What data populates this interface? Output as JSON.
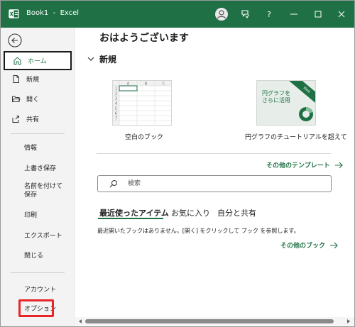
{
  "titlebar": {
    "document_name": "Book1",
    "separator": "-",
    "app_name": "Excel",
    "title": "Book1  -  Excel",
    "help_label": "?"
  },
  "sidebar": {
    "items": [
      {
        "label": "ホーム",
        "icon": "home-icon",
        "active": true
      },
      {
        "label": "新規",
        "icon": "new-document-icon"
      },
      {
        "label": "開く",
        "icon": "open-folder-icon"
      },
      {
        "label": "共有",
        "icon": "share-icon"
      }
    ],
    "sub_items": [
      {
        "label": "情報"
      },
      {
        "label": "上書き保存"
      },
      {
        "label": "名前を付けて保存"
      },
      {
        "label": "印刷"
      },
      {
        "label": "エクスポート"
      },
      {
        "label": "閉じる"
      }
    ],
    "bottom_items": [
      {
        "label": "アカウント"
      },
      {
        "label": "オプション",
        "highlighted": true
      }
    ]
  },
  "main": {
    "greeting": "おはようございます",
    "new_section": {
      "heading": "新規",
      "templates": [
        {
          "label": "空白のブック"
        },
        {
          "label": "円グラフのチュートリアルを超えて",
          "thumbnail_text": "円グラフを\nさらに活用",
          "ribbon_text": "New"
        }
      ],
      "more_templates_link": "その他のテンプレート"
    },
    "search": {
      "placeholder": "検索",
      "value": ""
    },
    "tabs": [
      {
        "label": "最近使ったアイテム",
        "active": true
      },
      {
        "label": "お気に入り"
      },
      {
        "label": "自分と共有"
      }
    ],
    "empty_message": "最近開いたブックはありません。[開く] をクリックして ブック を参照します。",
    "more_workbooks_link": "その他のブック"
  },
  "spreadsheet_thumb": {
    "columns": [
      "A",
      "B",
      "C"
    ],
    "rows": [
      "1",
      "2",
      "3",
      "4",
      "5",
      "6",
      "7"
    ]
  },
  "colors": {
    "titlebar": "#1f7145",
    "accent": "#1f7145",
    "sidebar_bg": "#f3f3f3",
    "highlight": "#e8262a"
  }
}
